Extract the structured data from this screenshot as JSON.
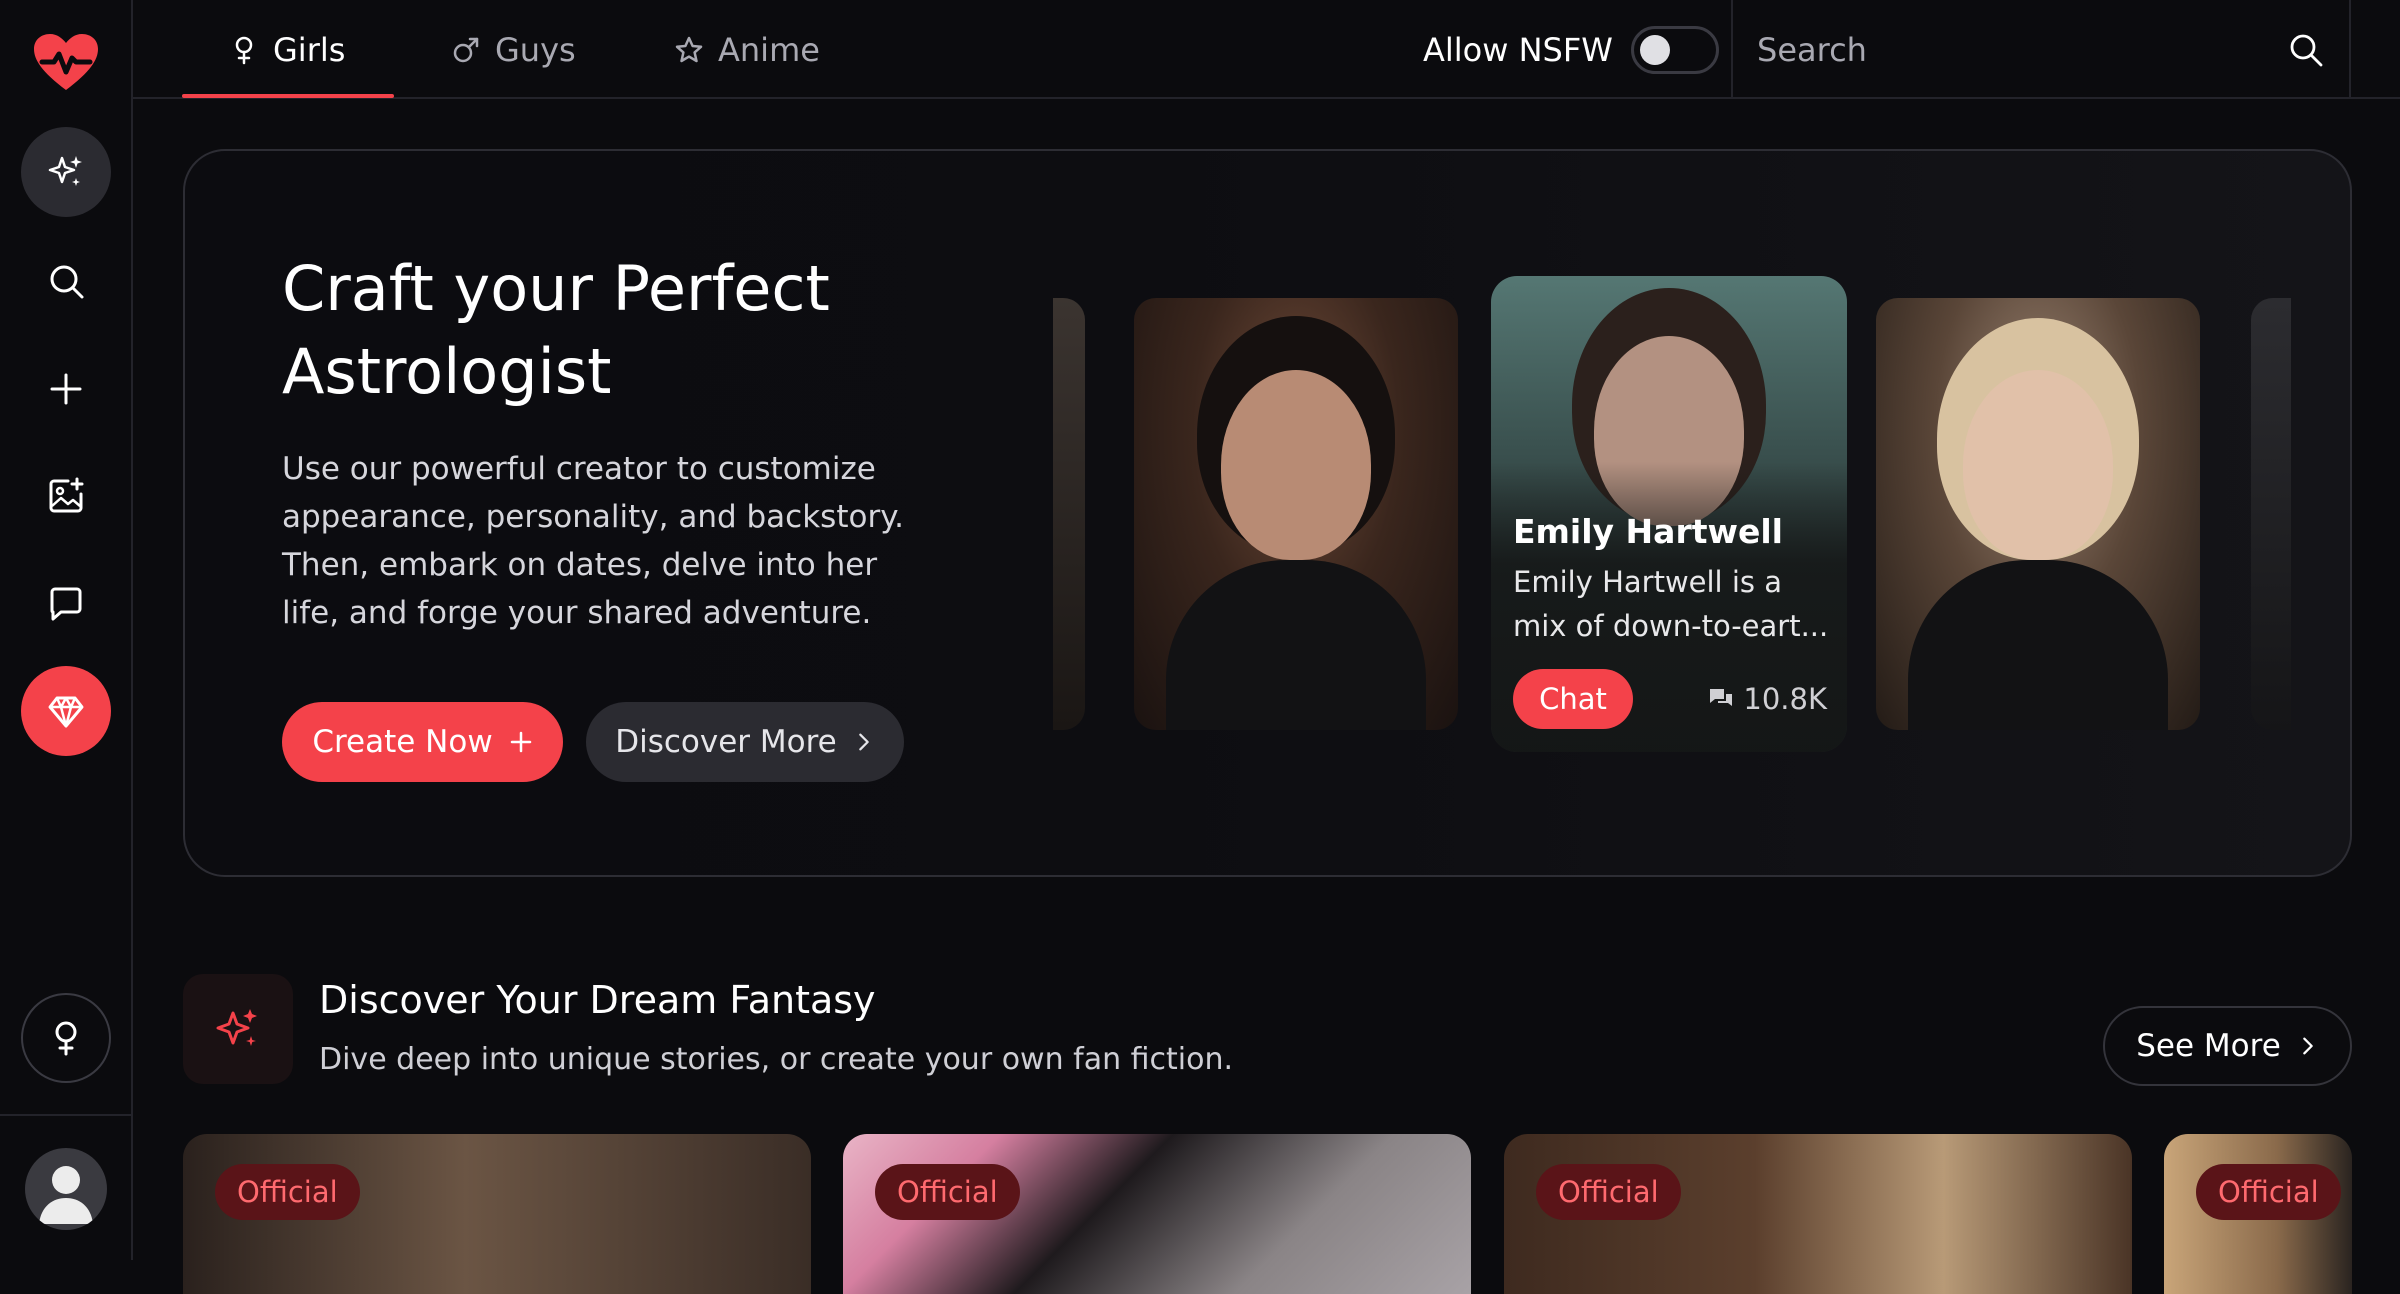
{
  "colors": {
    "accent": "#f4424a",
    "background": "#0b0b0e",
    "badge_bg": "#5a1418",
    "badge_text": "#ff6a6f"
  },
  "sidebar": {
    "logo_icon": "heart-pulse-icon",
    "items": [
      {
        "icon": "sparkles-icon",
        "active": true
      },
      {
        "icon": "search-icon",
        "active": false
      },
      {
        "icon": "plus-icon",
        "active": false
      },
      {
        "icon": "image-add-icon",
        "active": false
      },
      {
        "icon": "chat-bubble-icon",
        "active": false
      },
      {
        "icon": "diamond-icon",
        "active": false
      }
    ],
    "gender_icon": "female-icon",
    "avatar_icon": "user-avatar-icon"
  },
  "topbar": {
    "tabs": [
      {
        "label": "Girls",
        "icon": "female-icon",
        "active": true
      },
      {
        "label": "Guys",
        "icon": "male-icon",
        "active": false
      },
      {
        "label": "Anime",
        "icon": "star-icon",
        "active": false
      }
    ],
    "nsfw_label": "Allow NSFW",
    "nsfw_enabled": false,
    "search_placeholder": "Search"
  },
  "hero": {
    "title": "Craft your Perfect Astrologist",
    "description": "Use our powerful creator to customize appearance, personality, and backstory. Then, embark on dates, delve into her life, and forge your shared adventure.",
    "create_label": "Create Now",
    "discover_label": "Discover More",
    "featured": {
      "name": "Emily Hartwell",
      "description": "Emily Hartwell is a mix of down-to-eart...",
      "chat_label": "Chat",
      "chat_count": "10.8K"
    }
  },
  "section": {
    "title": "Discover Your Dream Fantasy",
    "subtitle": "Dive deep into unique stories, or create your own fan fiction.",
    "see_more_label": "See More",
    "cards": [
      {
        "badge": "Official"
      },
      {
        "badge": "Official"
      },
      {
        "badge": "Official"
      },
      {
        "badge": "Official"
      }
    ]
  }
}
